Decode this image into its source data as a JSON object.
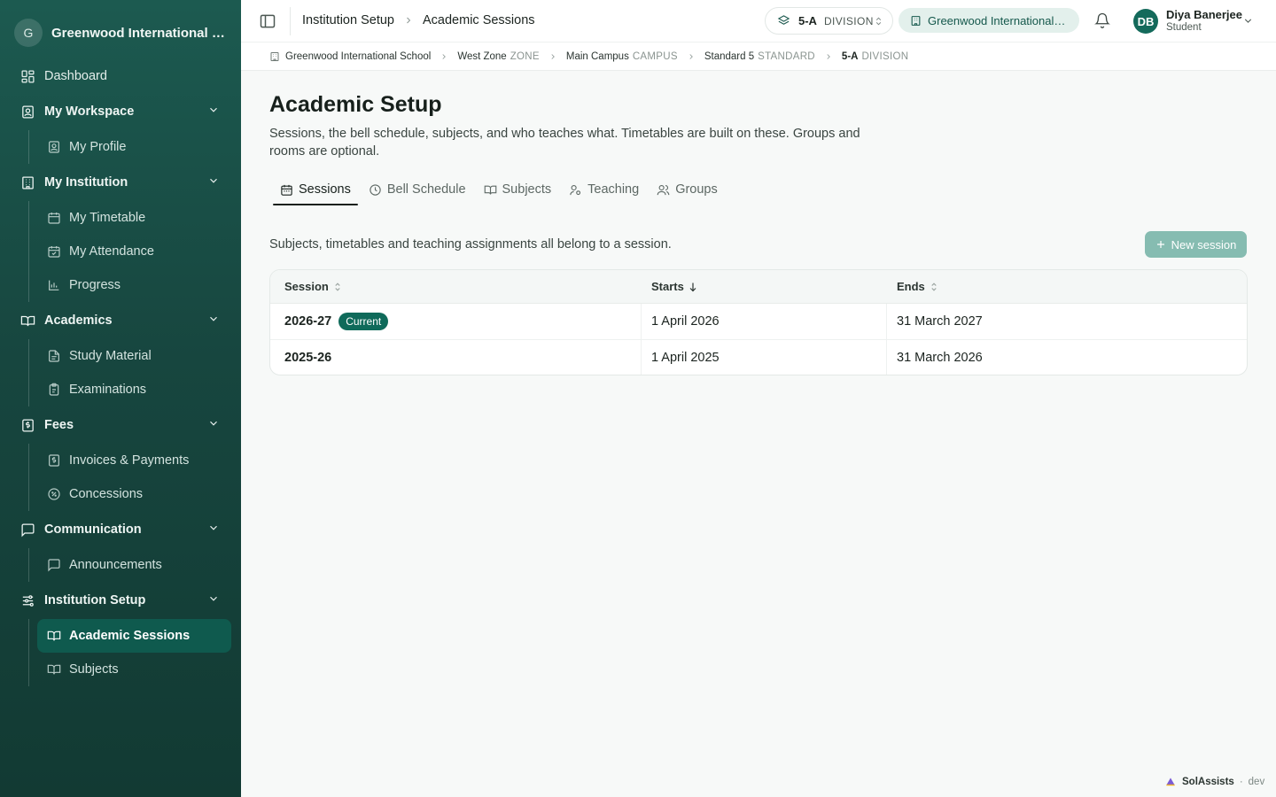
{
  "sidebar": {
    "brand_initial": "G",
    "brand_name": "Greenwood International School",
    "dashboard": "Dashboard",
    "groups": [
      {
        "label": "My Workspace",
        "items": [
          "My Profile"
        ]
      },
      {
        "label": "My Institution",
        "items": [
          "My Timetable",
          "My Attendance",
          "Progress"
        ]
      },
      {
        "label": "Academics",
        "items": [
          "Study Material",
          "Examinations"
        ]
      },
      {
        "label": "Fees",
        "items": [
          "Invoices & Payments",
          "Concessions"
        ]
      },
      {
        "label": "Communication",
        "items": [
          "Announcements"
        ]
      },
      {
        "label": "Institution Setup",
        "items": [
          "Academic Sessions",
          "Subjects"
        ]
      }
    ],
    "active_item": "Academic Sessions"
  },
  "header": {
    "breadcrumb": [
      "Institution Setup",
      "Academic Sessions"
    ],
    "division_value": "5-A",
    "division_kind": "DIVISION",
    "school": "Greenwood International School",
    "user": {
      "initials": "DB",
      "name": "Diya Banerjee",
      "role": "Student"
    }
  },
  "hierarchy": [
    {
      "name": "Greenwood International School",
      "kind": ""
    },
    {
      "name": "West Zone",
      "kind": "ZONE"
    },
    {
      "name": "Main Campus",
      "kind": "CAMPUS"
    },
    {
      "name": "Standard 5",
      "kind": "STANDARD"
    },
    {
      "name": "5-A",
      "kind": "DIVISION"
    }
  ],
  "page": {
    "title": "Academic Setup",
    "description": "Sessions, the bell schedule, subjects, and who teaches what. Timetables are built on these. Groups and rooms are optional.",
    "tabs": [
      "Sessions",
      "Bell Schedule",
      "Subjects",
      "Teaching",
      "Groups"
    ],
    "active_tab": "Sessions",
    "section_description": "Subjects, timetables and teaching assignments all belong to a session.",
    "new_button": "New session"
  },
  "table": {
    "columns": [
      "Session",
      "Starts",
      "Ends"
    ],
    "rows": [
      {
        "session": "2026-27",
        "badge": "Current",
        "starts": "1 April 2026",
        "ends": "31 March 2027"
      },
      {
        "session": "2025-26",
        "badge": "",
        "starts": "1 April 2025",
        "ends": "31 March 2026"
      }
    ]
  },
  "footer": {
    "brand": "SolAssists",
    "separator": "·",
    "env": "dev"
  },
  "colors": {
    "sidebar_bg": "#17463f",
    "accent": "#0f6a5a",
    "active_item_bg": "#0f5a4e",
    "button_disabled": "#86bcb1"
  }
}
